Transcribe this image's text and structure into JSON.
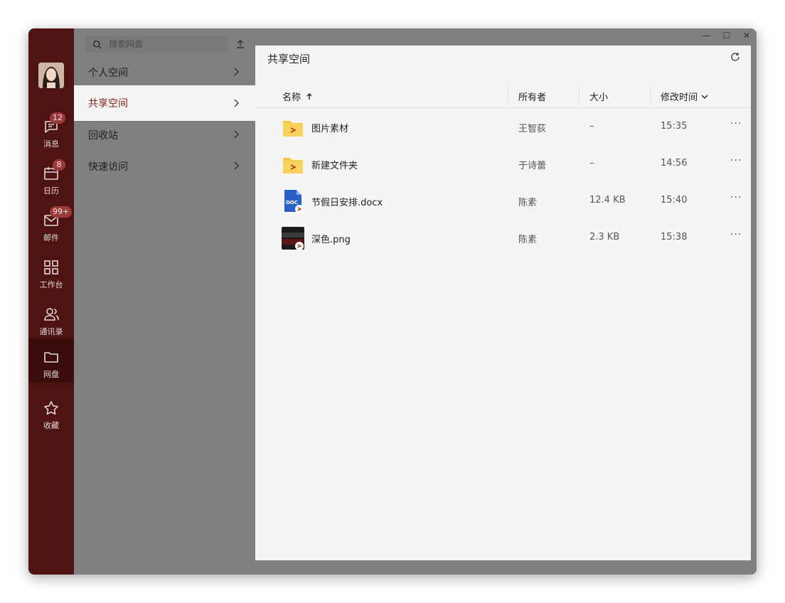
{
  "rail": {
    "items": [
      {
        "label": "消息",
        "badge": "12",
        "icon": "message-icon"
      },
      {
        "label": "日历",
        "badge": "8",
        "icon": "calendar-icon"
      },
      {
        "label": "邮件",
        "badge": "99+",
        "icon": "mail-icon"
      },
      {
        "label": "工作台",
        "badge": "",
        "icon": "grid-icon"
      },
      {
        "label": "通讯录",
        "badge": "",
        "icon": "contacts-icon"
      },
      {
        "label": "网盘",
        "badge": "",
        "icon": "folder-icon",
        "active": true
      },
      {
        "label": "收藏",
        "badge": "",
        "icon": "star-icon"
      }
    ]
  },
  "nav": {
    "search_placeholder": "搜索网盘",
    "items": [
      {
        "label": "个人空间"
      },
      {
        "label": "共享空间",
        "active": true
      },
      {
        "label": "回收站"
      },
      {
        "label": "快速访问"
      }
    ]
  },
  "main": {
    "title": "共享空间",
    "columns": {
      "name": "名称",
      "owner": "所有者",
      "size": "大小",
      "modified": "修改时间"
    },
    "rows": [
      {
        "name": "图片素材",
        "owner": "王智荻",
        "size": "–",
        "time": "15:35",
        "type": "shared-folder"
      },
      {
        "name": "新建文件夹",
        "owner": "于诗蕾",
        "size": "–",
        "time": "14:56",
        "type": "shared-folder"
      },
      {
        "name": "节假日安排.docx",
        "owner": "陈素",
        "size": "12.4 KB",
        "time": "15:40",
        "type": "docx",
        "type_label": "DOC"
      },
      {
        "name": "深色.png",
        "owner": "陈素",
        "size": "2.3 KB",
        "time": "15:38",
        "type": "png"
      }
    ],
    "more_label": "···"
  },
  "window_controls": {
    "minimize": "—",
    "maximize": "☐",
    "close": "✕"
  },
  "colors": {
    "rail_bg": "#4e1414",
    "accent": "#8a2020",
    "badge": "#9c3a3a",
    "folder": "#f5c842"
  }
}
